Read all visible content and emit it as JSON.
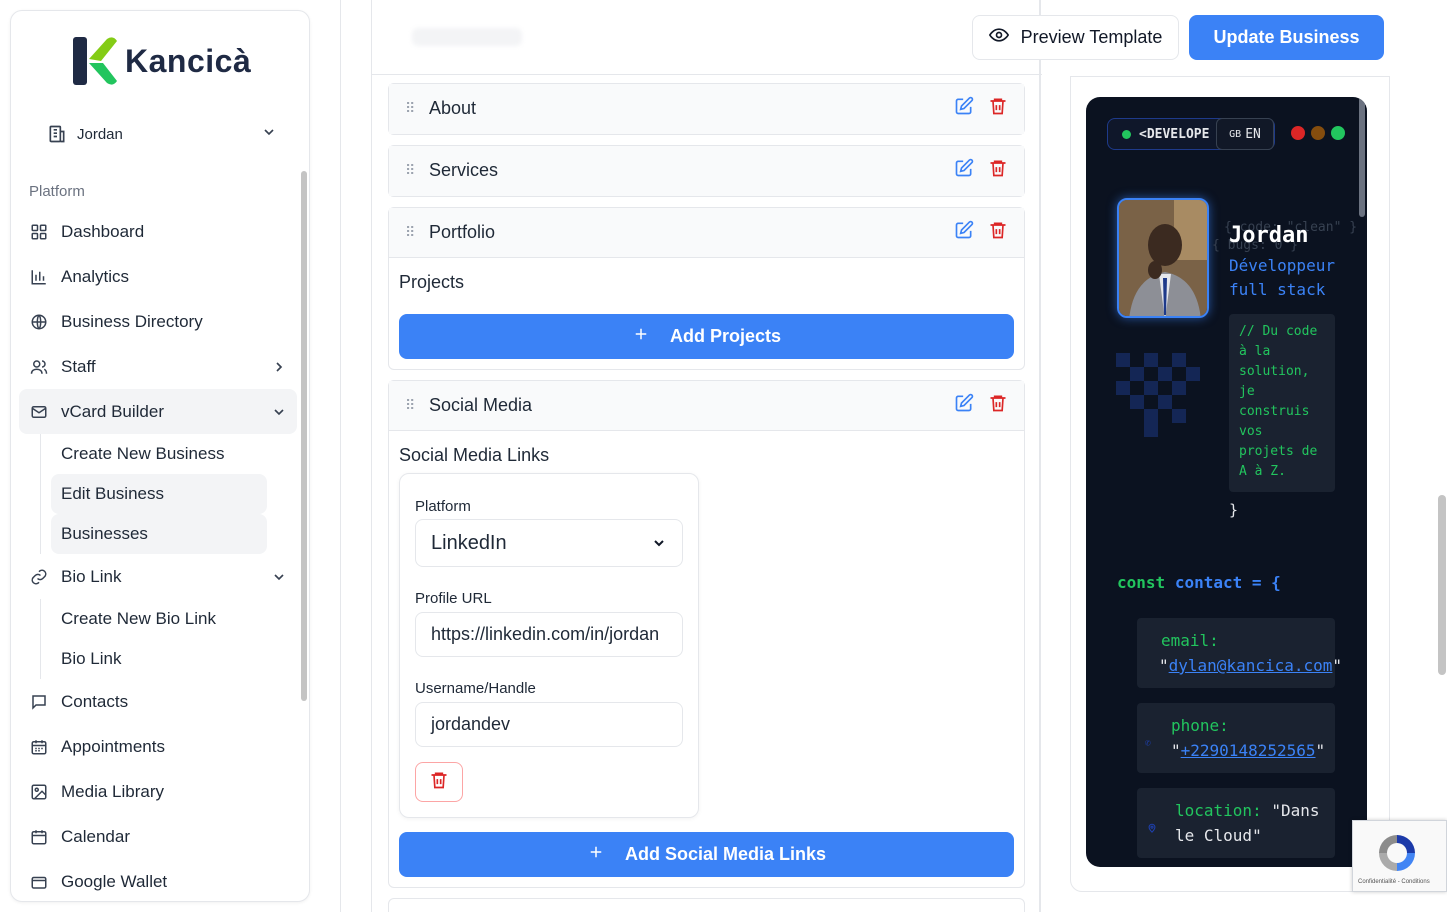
{
  "brand": {
    "name": "Kancicà"
  },
  "business_selector": {
    "value": "Jordan"
  },
  "sidebar": {
    "section_label": "Platform",
    "items": [
      {
        "label": "Dashboard",
        "icon": "grid-icon"
      },
      {
        "label": "Analytics",
        "icon": "bar-chart-icon"
      },
      {
        "label": "Business Directory",
        "icon": "globe-icon"
      },
      {
        "label": "Staff",
        "icon": "users-icon"
      },
      {
        "label": "vCard Builder",
        "icon": "mail-icon"
      },
      {
        "label": "Bio Link",
        "icon": "link-icon"
      },
      {
        "label": "Contacts",
        "icon": "message-square-icon"
      },
      {
        "label": "Appointments",
        "icon": "calendar-grid-icon"
      },
      {
        "label": "Media Library",
        "icon": "image-icon"
      },
      {
        "label": "Calendar",
        "icon": "calendar-icon"
      },
      {
        "label": "Google Wallet",
        "icon": "wallet-icon"
      }
    ],
    "vcard_sub": [
      "Create New Business",
      "Edit Business",
      "Businesses"
    ],
    "biolink_sub": [
      "Create New Bio Link",
      "Bio Link"
    ]
  },
  "toolbar": {
    "preview_label": "Preview Template",
    "update_label": "Update Business"
  },
  "sections": {
    "about": "About",
    "services": "Services",
    "portfolio": "Portfolio",
    "social": "Social Media"
  },
  "portfolio": {
    "heading": "Projects",
    "add_label": "Add Projects"
  },
  "social": {
    "heading": "Social Media Links",
    "platform_label": "Platform",
    "platform_value": "LinkedIn",
    "url_label": "Profile URL",
    "url_value": "https://linkedin.com/in/jordan",
    "handle_label": "Username/Handle",
    "handle_value": "jordandev",
    "add_label": "Add Social Media Links"
  },
  "preview": {
    "badge": "<DEVELOPE",
    "lang": "EN",
    "lang_flag": "GB",
    "ghost_code_1": "{ code: \"clean\" }",
    "ghost_code_2": "{ bugs: 0 }",
    "name": "Jordan",
    "role": "Développeur full stack",
    "comment": "// Du code à la solution, je construis vos projets de A à Z.",
    "brace": "}",
    "const_kw": "const",
    "const_name": "contact = {",
    "email_key": "email:",
    "email_value": "dylan@kancica.com",
    "phone_key": "phone:",
    "phone_value": "+2290148252565",
    "location_key": "location:",
    "location_value": "\"Dans le Cloud\""
  },
  "recaptcha": {
    "text": "Confidentialité - Conditions"
  },
  "colors": {
    "accent": "#3b82f6",
    "danger": "#dc2626",
    "terminal_bg": "#0b1220",
    "code_green": "#22c55e"
  }
}
